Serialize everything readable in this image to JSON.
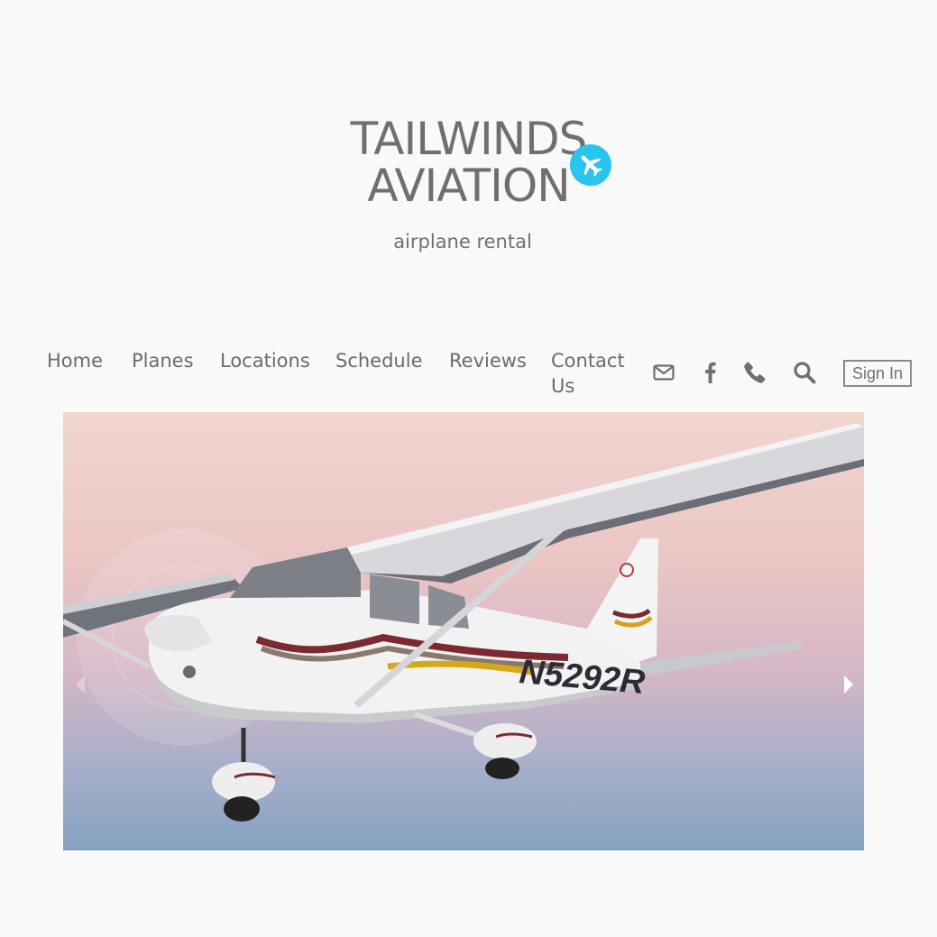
{
  "brand": {
    "title_line1": "TAILWINDS",
    "title_line2": "AVIATION",
    "tagline": "airplane rental",
    "badge_icon": "airplane-icon",
    "badge_color": "#29c5ef"
  },
  "nav": {
    "items": [
      {
        "label": "Home"
      },
      {
        "label": "Planes"
      },
      {
        "label": "Locations"
      },
      {
        "label": "Schedule"
      },
      {
        "label": "Reviews"
      },
      {
        "label": "Contact Us"
      }
    ],
    "icons": [
      "envelope-icon",
      "facebook-icon",
      "phone-icon",
      "search-icon"
    ],
    "sign_in": "Sign In"
  },
  "hero": {
    "tail_number": "N5292R",
    "prev_icon": "chevron-left-icon",
    "next_icon": "chevron-right-icon"
  }
}
